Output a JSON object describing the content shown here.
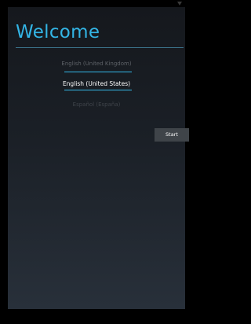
{
  "welcome": {
    "title": "Welcome"
  },
  "languages": {
    "items": [
      "English (United Kingdom)",
      "English (United States)",
      "Español (España)"
    ],
    "selected": "English (United States)"
  },
  "actions": {
    "start_label": "Start"
  },
  "colors": {
    "accent": "#33b5e5",
    "background_top": "#15181d",
    "background_bottom": "#28303a",
    "button": "#3f4449"
  },
  "icons": {
    "status": "signal-icon"
  }
}
